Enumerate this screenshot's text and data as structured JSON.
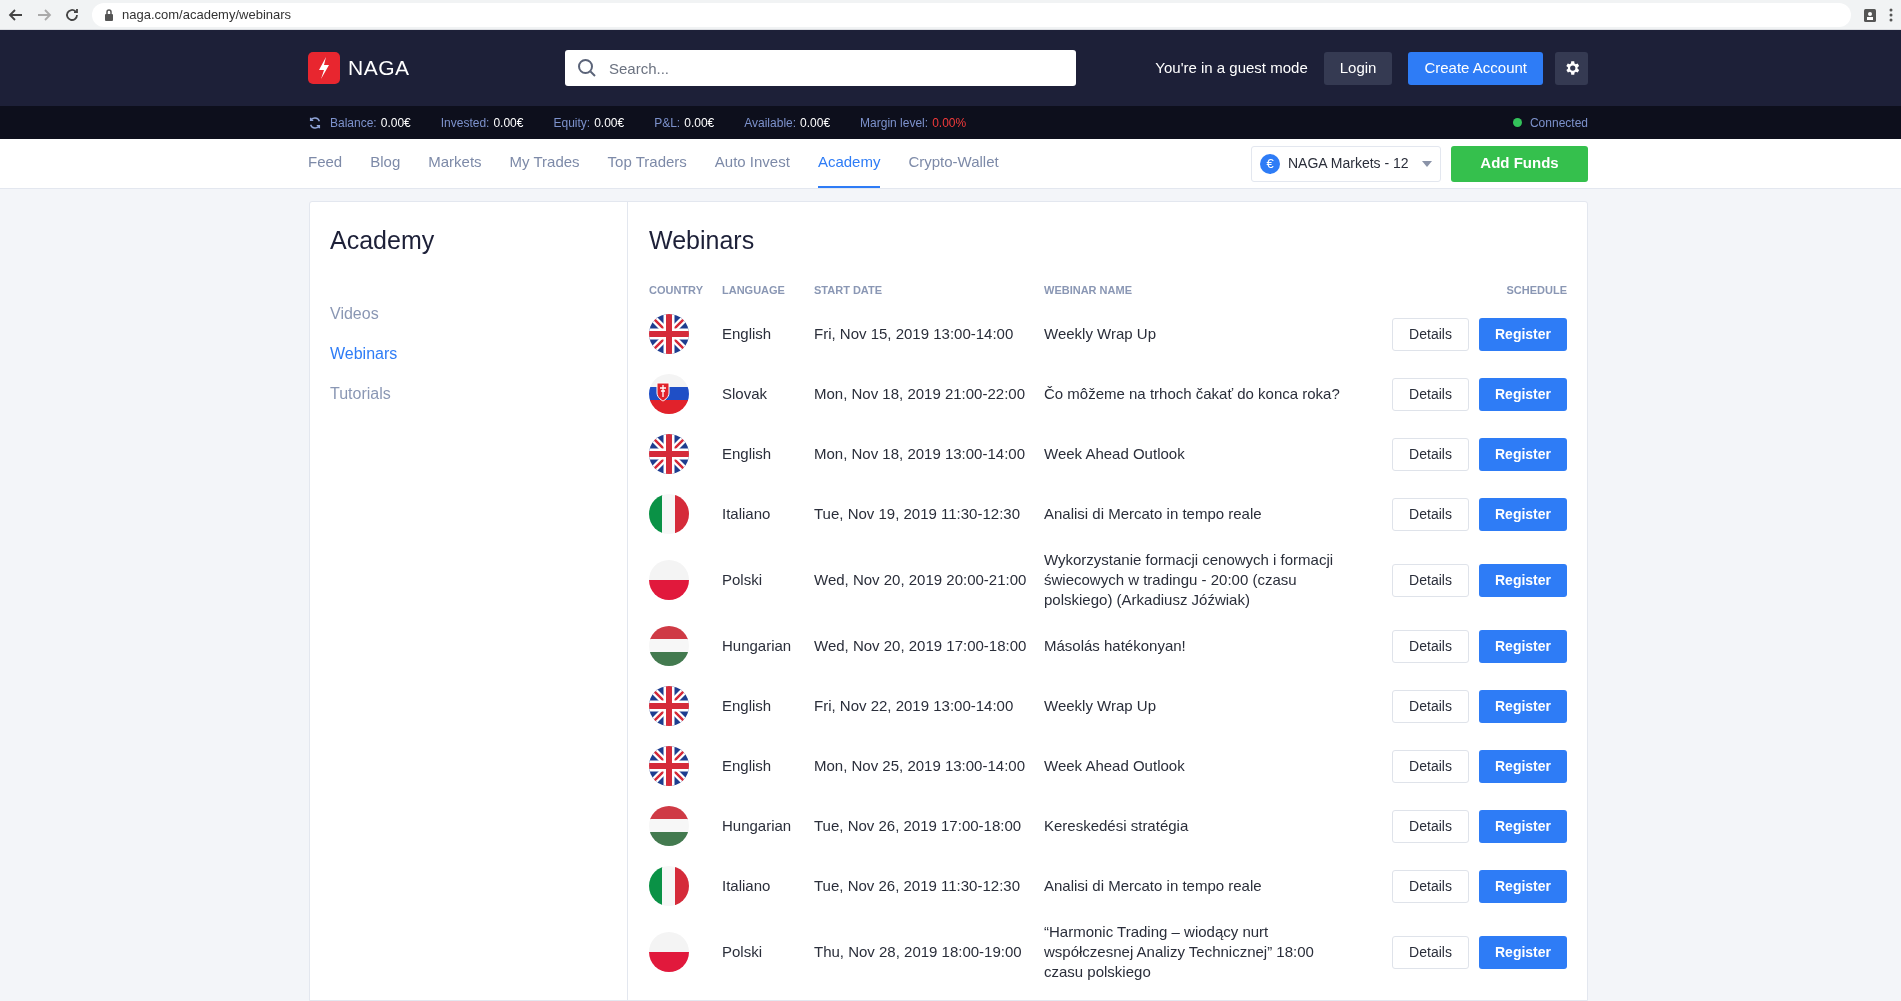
{
  "browser": {
    "url": "naga.com/academy/webinars"
  },
  "header": {
    "logo": "NAGA",
    "search": {
      "placeholder": "Search..."
    },
    "guest_text": "You're in a guest mode",
    "login": "Login",
    "create_account": "Create Account"
  },
  "stats": [
    {
      "label": "Balance:",
      "value": "0.00€",
      "kind": "normal"
    },
    {
      "label": "Invested:",
      "value": "0.00€",
      "kind": "normal"
    },
    {
      "label": "Equity:",
      "value": "0.00€",
      "kind": "normal"
    },
    {
      "label": "P&L:",
      "value": "0.00€",
      "kind": "normal"
    },
    {
      "label": "Available:",
      "value": "0.00€",
      "kind": "normal"
    },
    {
      "label": "Margin level:",
      "value": "0.00%",
      "kind": "alert"
    }
  ],
  "connection": {
    "label": "Connected",
    "connected": true
  },
  "nav": [
    {
      "label": "Feed",
      "selected": false
    },
    {
      "label": "Blog",
      "selected": false
    },
    {
      "label": "Markets",
      "selected": false
    },
    {
      "label": "My Trades",
      "selected": false
    },
    {
      "label": "Top Traders",
      "selected": false
    },
    {
      "label": "Auto Invest",
      "selected": false
    },
    {
      "label": "Academy",
      "selected": true
    },
    {
      "label": "Crypto-Wallet",
      "selected": false
    }
  ],
  "account_select": "NAGA Markets - 12",
  "currency_symbol": "€",
  "add_funds": "Add Funds",
  "sidebar": {
    "title": "Academy",
    "items": [
      {
        "label": "Videos",
        "selected": false
      },
      {
        "label": "Webinars",
        "selected": true
      },
      {
        "label": "Tutorials",
        "selected": false
      }
    ]
  },
  "main": {
    "title": "Webinars",
    "columns": [
      "COUNTRY",
      "LANGUAGE",
      "START DATE",
      "WEBINAR NAME",
      "SCHEDULE"
    ],
    "rows": [
      {
        "kind": "uk",
        "language": "English",
        "start": "Fri, Nov 15, 2019 13:00-14:00",
        "name": "Weekly Wrap Up",
        "details": "Details",
        "register": "Register"
      },
      {
        "kind": "sk",
        "language": "Slovak",
        "start": "Mon, Nov 18, 2019 21:00-22:00",
        "name": "Čo môžeme na trhoch čakať do konca roka?",
        "details": "Details",
        "register": "Register"
      },
      {
        "kind": "uk",
        "language": "English",
        "start": "Mon, Nov 18, 2019 13:00-14:00",
        "name": "Week Ahead Outlook",
        "details": "Details",
        "register": "Register"
      },
      {
        "kind": "it",
        "language": "Italiano",
        "start": "Tue, Nov 19, 2019 11:30-12:30",
        "name": "Analisi di Mercato in tempo reale",
        "details": "Details",
        "register": "Register"
      },
      {
        "kind": "pl",
        "language": "Polski",
        "start": "Wed, Nov 20, 2019 20:00-21:00",
        "name": "Wykorzystanie formacji cenowych i formacji świecowych w tradingu - 20:00 (czasu polskiego) (Arkadiusz Jóźwiak)",
        "details": "Details",
        "register": "Register"
      },
      {
        "kind": "hu",
        "language": "Hungarian",
        "start": "Wed, Nov 20, 2019 17:00-18:00",
        "name": "Másolás hatékonyan!",
        "details": "Details",
        "register": "Register"
      },
      {
        "kind": "uk",
        "language": "English",
        "start": "Fri, Nov 22, 2019 13:00-14:00",
        "name": "Weekly Wrap Up",
        "details": "Details",
        "register": "Register"
      },
      {
        "kind": "uk",
        "language": "English",
        "start": "Mon, Nov 25, 2019 13:00-14:00",
        "name": "Week Ahead Outlook",
        "details": "Details",
        "register": "Register"
      },
      {
        "kind": "hu",
        "language": "Hungarian",
        "start": "Tue, Nov 26, 2019 17:00-18:00",
        "name": "Kereskedési stratégia",
        "details": "Details",
        "register": "Register"
      },
      {
        "kind": "it",
        "language": "Italiano",
        "start": "Tue, Nov 26, 2019 11:30-12:30",
        "name": "Analisi di Mercato in tempo reale",
        "details": "Details",
        "register": "Register"
      },
      {
        "kind": "pl",
        "language": "Polski",
        "start": "Thu, Nov 28, 2019 18:00-19:00",
        "name": "“Harmonic Trading – wiodący nurt współczesnej Analizy Technicznej” 18:00 czasu polskiego",
        "details": "Details",
        "register": "Register"
      }
    ]
  }
}
